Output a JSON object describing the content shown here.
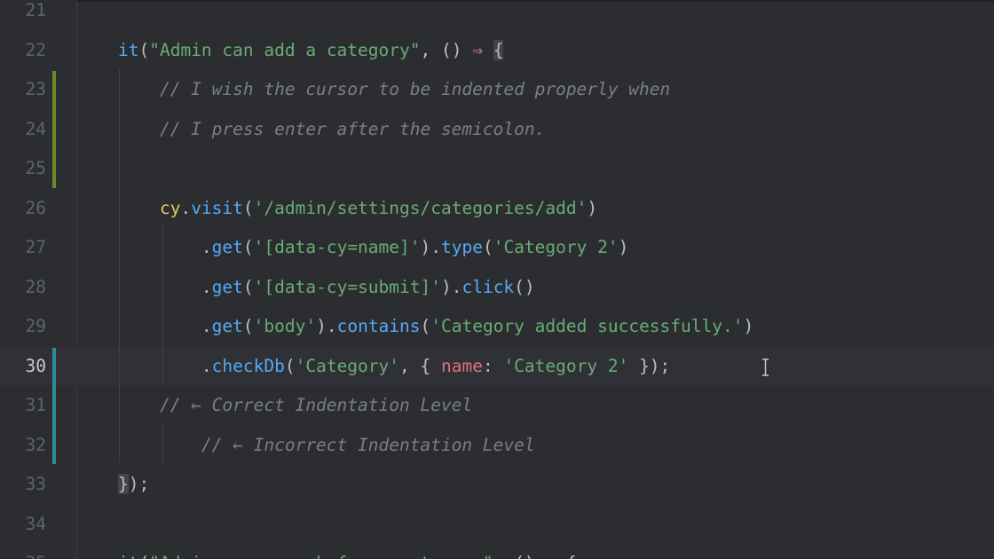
{
  "editor": {
    "lines": [
      {
        "number": "21",
        "segments": []
      },
      {
        "number": "22",
        "segments": [
          {
            "text": "it",
            "cls": "c-fn"
          },
          {
            "text": "(",
            "cls": "c-punc"
          },
          {
            "text": "\"Admin can add a category\"",
            "cls": "c-str"
          },
          {
            "text": ", () ",
            "cls": "c-punc"
          },
          {
            "text": "⇒",
            "cls": "c-kw"
          },
          {
            "text": " ",
            "cls": "c-punc"
          },
          {
            "text": "{",
            "cls": "c-punc bracket-hl"
          }
        ]
      },
      {
        "number": "23",
        "segments": [
          {
            "text": "    // I wish the cursor to be indented properly when",
            "cls": "c-cmt"
          }
        ]
      },
      {
        "number": "24",
        "segments": [
          {
            "text": "    // I press enter after the semicolon.",
            "cls": "c-cmt"
          }
        ]
      },
      {
        "number": "25",
        "segments": []
      },
      {
        "number": "26",
        "segments": [
          {
            "text": "    ",
            "cls": "c-punc"
          },
          {
            "text": "cy",
            "cls": "c-obj"
          },
          {
            "text": ".",
            "cls": "c-punc"
          },
          {
            "text": "visit",
            "cls": "c-fn"
          },
          {
            "text": "(",
            "cls": "c-punc"
          },
          {
            "text": "'/admin/settings/categories/add'",
            "cls": "c-str"
          },
          {
            "text": ")",
            "cls": "c-punc"
          }
        ]
      },
      {
        "number": "27",
        "segments": [
          {
            "text": "        .",
            "cls": "c-punc"
          },
          {
            "text": "get",
            "cls": "c-fn"
          },
          {
            "text": "(",
            "cls": "c-punc"
          },
          {
            "text": "'[data-cy=name]'",
            "cls": "c-str"
          },
          {
            "text": ").",
            "cls": "c-punc"
          },
          {
            "text": "type",
            "cls": "c-fn"
          },
          {
            "text": "(",
            "cls": "c-punc"
          },
          {
            "text": "'Category 2'",
            "cls": "c-str"
          },
          {
            "text": ")",
            "cls": "c-punc"
          }
        ]
      },
      {
        "number": "28",
        "segments": [
          {
            "text": "        .",
            "cls": "c-punc"
          },
          {
            "text": "get",
            "cls": "c-fn"
          },
          {
            "text": "(",
            "cls": "c-punc"
          },
          {
            "text": "'[data-cy=submit]'",
            "cls": "c-str"
          },
          {
            "text": ").",
            "cls": "c-punc"
          },
          {
            "text": "click",
            "cls": "c-fn"
          },
          {
            "text": "()",
            "cls": "c-punc"
          }
        ]
      },
      {
        "number": "29",
        "segments": [
          {
            "text": "        .",
            "cls": "c-punc"
          },
          {
            "text": "get",
            "cls": "c-fn"
          },
          {
            "text": "(",
            "cls": "c-punc"
          },
          {
            "text": "'body'",
            "cls": "c-str"
          },
          {
            "text": ").",
            "cls": "c-punc"
          },
          {
            "text": "contains",
            "cls": "c-fn"
          },
          {
            "text": "(",
            "cls": "c-punc"
          },
          {
            "text": "'Category added successfully.'",
            "cls": "c-str"
          },
          {
            "text": ")",
            "cls": "c-punc"
          }
        ]
      },
      {
        "number": "30",
        "segments": [
          {
            "text": "        .",
            "cls": "c-punc"
          },
          {
            "text": "checkDb",
            "cls": "c-fn"
          },
          {
            "text": "(",
            "cls": "c-punc"
          },
          {
            "text": "'Category'",
            "cls": "c-str"
          },
          {
            "text": ", { ",
            "cls": "c-punc"
          },
          {
            "text": "name",
            "cls": "c-prop"
          },
          {
            "text": ": ",
            "cls": "c-punc"
          },
          {
            "text": "'Category 2'",
            "cls": "c-str"
          },
          {
            "text": " });",
            "cls": "c-punc"
          }
        ]
      },
      {
        "number": "31",
        "segments": [
          {
            "text": "    // ← Correct Indentation Level",
            "cls": "c-cmt"
          }
        ]
      },
      {
        "number": "32",
        "segments": [
          {
            "text": "        // ← Incorrect Indentation Level",
            "cls": "c-cmt"
          }
        ]
      },
      {
        "number": "33",
        "segments": [
          {
            "text": "}",
            "cls": "c-punc bracket-hl"
          },
          {
            "text": ");",
            "cls": "c-punc"
          }
        ]
      },
      {
        "number": "34",
        "segments": []
      },
      {
        "number": "35",
        "segments": [
          {
            "text": "it",
            "cls": "c-fn"
          },
          {
            "text": "(",
            "cls": "c-punc"
          },
          {
            "text": "\"Admin can search for a category\"",
            "cls": "c-str"
          },
          {
            "text": ", () ",
            "cls": "c-punc"
          },
          {
            "text": "⇒",
            "cls": "c-kw"
          },
          {
            "text": " {",
            "cls": "c-punc"
          }
        ]
      }
    ],
    "current_line": "30",
    "change_markers": [
      {
        "from": "23",
        "to": "25",
        "color": "#6a8a2a",
        "name": "added-lines-marker"
      },
      {
        "from": "30",
        "to": "32",
        "color": "#2e8a94",
        "name": "modified-lines-marker"
      }
    ]
  }
}
